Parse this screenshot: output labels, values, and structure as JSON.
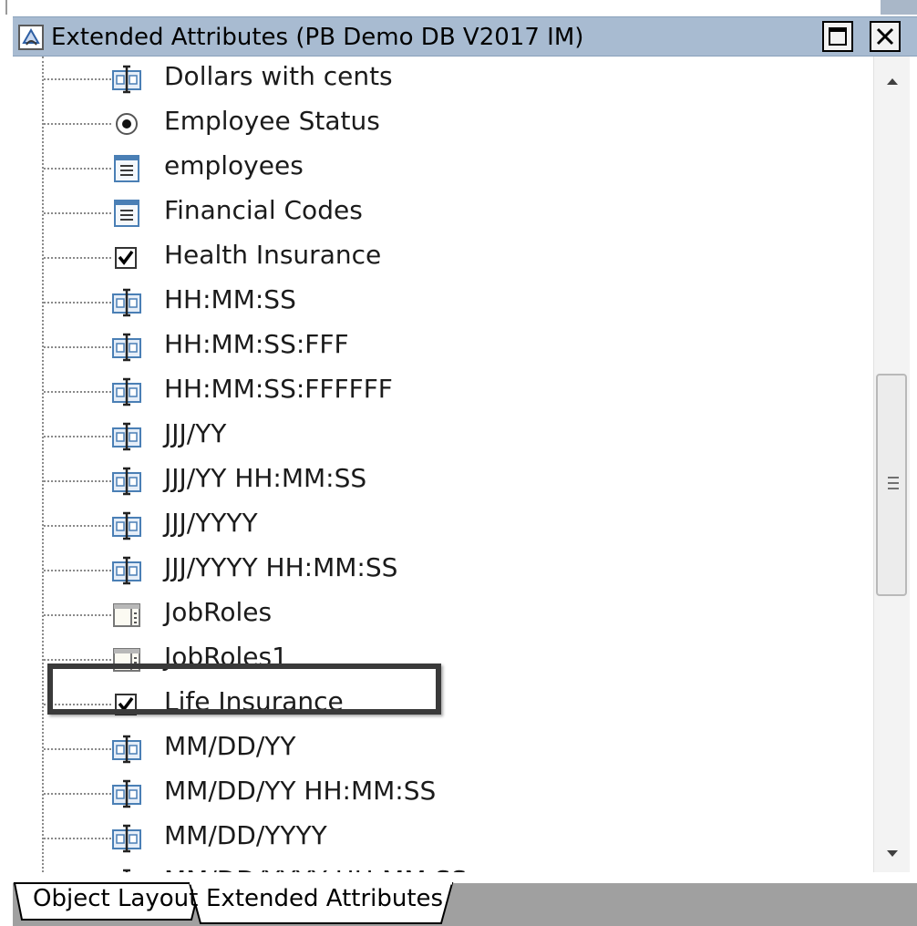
{
  "window": {
    "title": "Extended Attributes (PB Demo DB V2017 IM)"
  },
  "tree": {
    "items": [
      {
        "label": "Dollars with cents",
        "icon": "edit-mask-icon"
      },
      {
        "label": "Employee Status",
        "icon": "radio-button-icon"
      },
      {
        "label": "employees",
        "icon": "list-icon"
      },
      {
        "label": "Financial Codes",
        "icon": "list-icon"
      },
      {
        "label": "Health Insurance",
        "icon": "checkbox-icon"
      },
      {
        "label": "HH:MM:SS",
        "icon": "edit-mask-icon"
      },
      {
        "label": "HH:MM:SS:FFF",
        "icon": "edit-mask-icon"
      },
      {
        "label": "HH:MM:SS:FFFFFF",
        "icon": "edit-mask-icon"
      },
      {
        "label": "JJJ/YY",
        "icon": "edit-mask-icon"
      },
      {
        "label": "JJJ/YY HH:MM:SS",
        "icon": "edit-mask-icon"
      },
      {
        "label": "JJJ/YYYY",
        "icon": "edit-mask-icon"
      },
      {
        "label": "JJJ/YYYY HH:MM:SS",
        "icon": "edit-mask-icon"
      },
      {
        "label": "JobRoles",
        "icon": "dropdown-datawindow-icon"
      },
      {
        "label": "JobRoles1",
        "icon": "dropdown-datawindow-icon",
        "highlighted": true
      },
      {
        "label": "Life Insurance",
        "icon": "checkbox-icon"
      },
      {
        "label": "MM/DD/YY",
        "icon": "edit-mask-icon"
      },
      {
        "label": "MM/DD/YY HH:MM:SS",
        "icon": "edit-mask-icon"
      },
      {
        "label": "MM/DD/YYYY",
        "icon": "edit-mask-icon"
      },
      {
        "label": "MM/DD/YYYY HH:MM:SS",
        "icon": "edit-mask-icon"
      }
    ]
  },
  "tabs": [
    {
      "label": "Object Layout",
      "active": false
    },
    {
      "label": "Extended Attributes",
      "active": true
    }
  ],
  "colors": {
    "titlebar": "#a8bbd1",
    "tab_strip": "#a0a0a0",
    "highlight_border": "#3a3a3a"
  }
}
